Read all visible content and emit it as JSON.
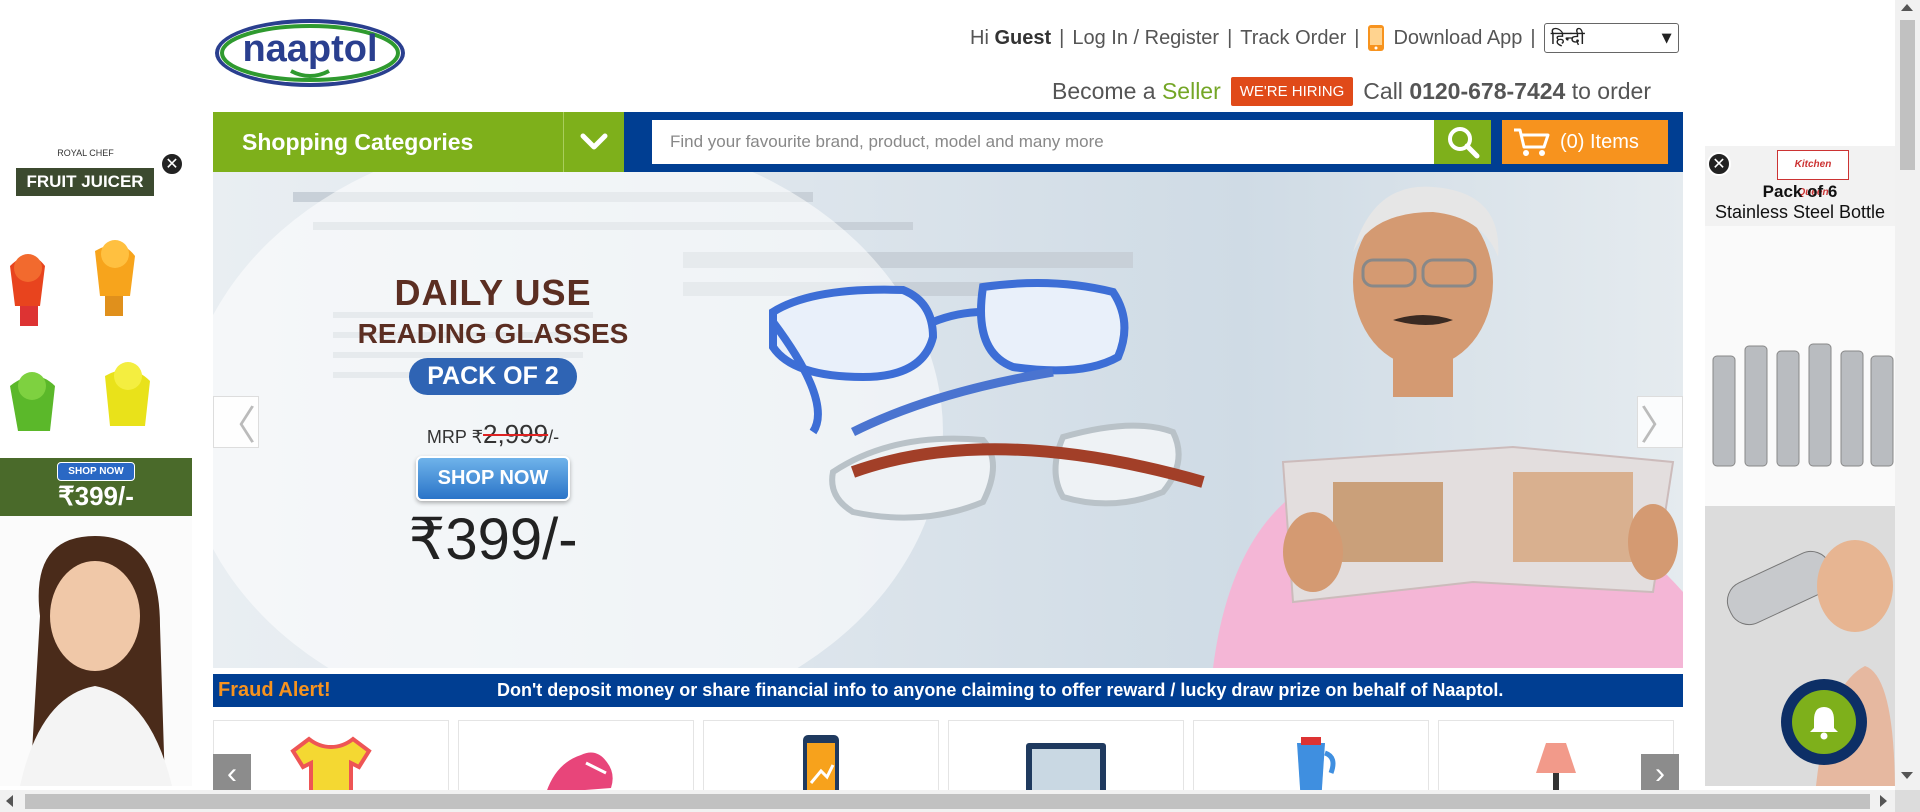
{
  "header": {
    "logo_text": "naaptol",
    "greeting_prefix": "Hi",
    "greeting_user": "Guest",
    "login_link": "Log In / Register",
    "track_order": "Track Order",
    "download_app": "Download App",
    "language_selected": "हिन्दी",
    "separator": "|",
    "become_a": "Become a",
    "seller": "Seller",
    "hiring_badge": "WE'RE HIRING",
    "call_prefix": "Call",
    "phone": "0120-678-7424",
    "call_suffix": "to order"
  },
  "nav": {
    "categories_label": "Shopping Categories",
    "search_placeholder": "Find your favourite brand, product, model and many more",
    "cart_label": "(0) Items"
  },
  "banner": {
    "line1": "DAILY USE",
    "line2": "READING GLASSES",
    "pack": "PACK OF 2",
    "mrp_label": "MRP ₹",
    "mrp_value": "2,999",
    "mrp_suffix": "/-",
    "shop_now": "SHOP NOW",
    "price": "₹399/-",
    "prev_arrow": "〈",
    "next_arrow": "〉"
  },
  "fraud": {
    "title": "Fraud Alert!",
    "message": "Don't deposit money or share financial info to anyone claiming to offer reward / lucky draw prize on behalf of Naaptol."
  },
  "tiles": [
    "tshirt-icon",
    "shoe-icon",
    "mobile-icon",
    "laptop-icon",
    "mixer-icon",
    "lamp-icon"
  ],
  "ad_left": {
    "brand": "ROYAL CHEF",
    "title": "FRUIT JUICER",
    "shop_now": "SHOP NOW",
    "price": "₹399/-",
    "close": "✕"
  },
  "ad_right": {
    "brand": "Kitchen Queen",
    "title_a": "Pack of 6",
    "title_b": "Stainless Steel Bottle",
    "close": "✕"
  },
  "colors": {
    "navy": "#003e92",
    "green": "#7eb01b",
    "orange": "#f7931e",
    "hiring_red": "#e04a19"
  }
}
